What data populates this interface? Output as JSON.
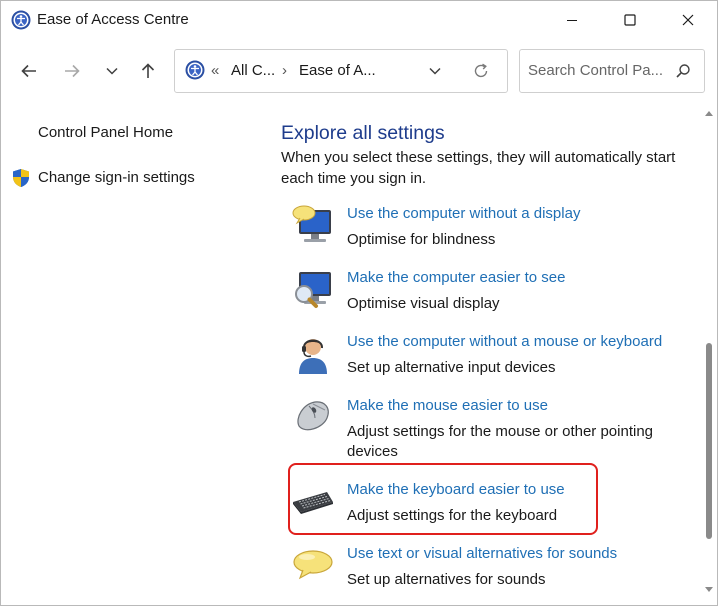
{
  "window": {
    "title": "Ease of Access Centre"
  },
  "titlebar": {
    "minimize_icon": "minimize-icon",
    "maximize_icon": "maximize-icon",
    "close_icon": "close-icon"
  },
  "nav": {
    "back_icon": "arrow-left-icon",
    "forward_icon": "arrow-right-icon",
    "recent_icon": "chevron-down-icon",
    "up_icon": "arrow-up-icon"
  },
  "address": {
    "overflow": "«",
    "segments": [
      "All C...",
      "Ease of A..."
    ],
    "separator": "›",
    "dropdown_icon": "chevron-down-icon",
    "refresh_icon": "refresh-icon"
  },
  "search": {
    "placeholder": "Search Control Pa...",
    "value": ""
  },
  "sidebar": {
    "home_label": "Control Panel Home",
    "signin_label": "Change sign-in settings"
  },
  "main": {
    "heading": "Explore all settings",
    "intro": "When you select these settings, they will automatically start each time you sign in.",
    "items": [
      {
        "icon": "monitor-speech-icon",
        "link": "Use the computer without a display",
        "desc": "Optimise for blindness"
      },
      {
        "icon": "monitor-magnifier-icon",
        "link": "Make the computer easier to see",
        "desc": "Optimise visual display"
      },
      {
        "icon": "headset-person-icon",
        "link": "Use the computer without a mouse or keyboard",
        "desc": "Set up alternative input devices"
      },
      {
        "icon": "mouse-icon",
        "link": "Make the mouse easier to use",
        "desc": "Adjust settings for the mouse or other pointing devices"
      },
      {
        "icon": "keyboard-icon",
        "link": "Make the keyboard easier to use",
        "desc": "Adjust settings for the keyboard"
      },
      {
        "icon": "speech-bubble-icon",
        "link": "Use text or visual alternatives for sounds",
        "desc": "Set up alternatives for sounds"
      }
    ]
  },
  "colors": {
    "link": "#1f6fb5",
    "heading": "#1e3c8c",
    "highlight": "#e0201d"
  }
}
